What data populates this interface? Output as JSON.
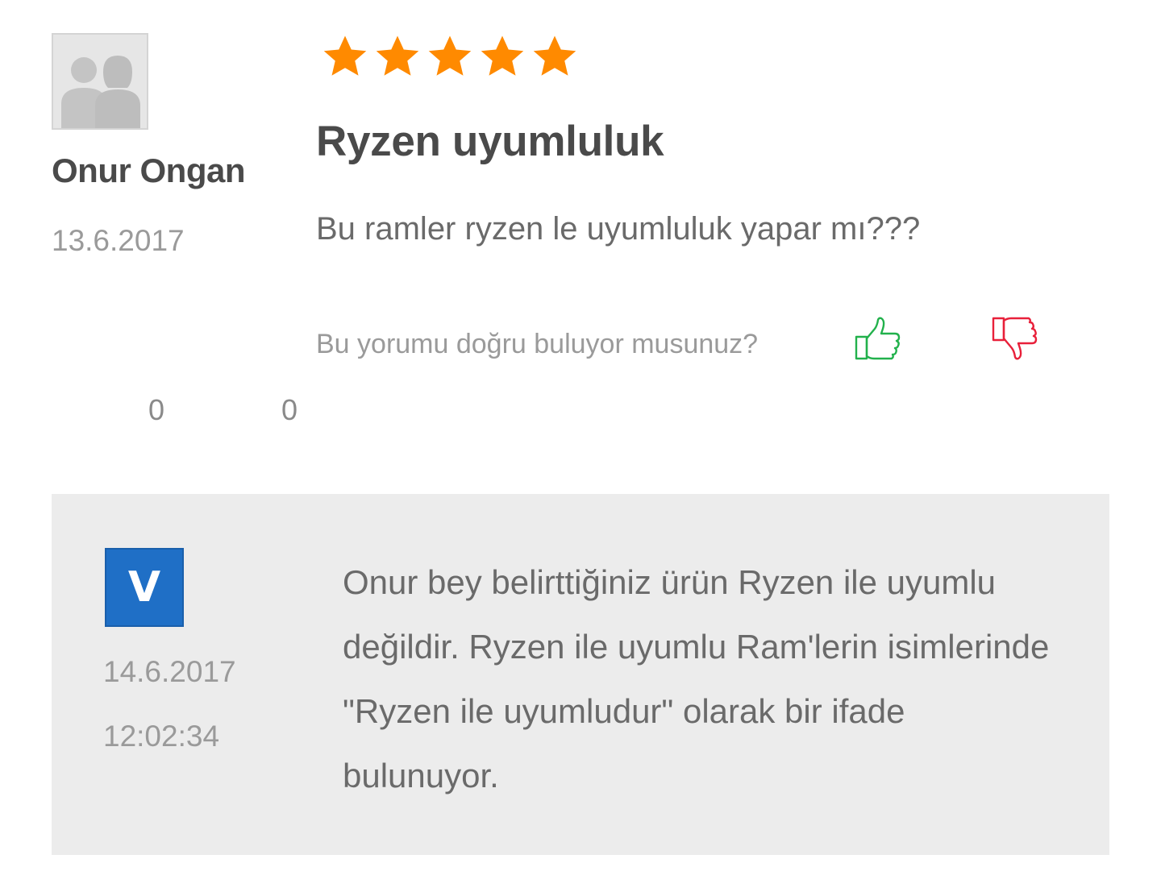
{
  "review": {
    "reviewer_name": "Onur Ongan",
    "date": "13.6.2017",
    "rating": 5,
    "rating_max": 5,
    "title": "Ryzen uyumluluk",
    "body": "Bu ramler ryzen le uyumluluk yapar mı???",
    "helpful_question": "Bu yorumu doğru buluyor musunuz?",
    "like_count": "0",
    "dislike_count": "0",
    "avatar_icon": "default-user-silhouette-icon",
    "like_icon": "thumbs-up-icon",
    "dislike_icon": "thumbs-down-icon",
    "colors": {
      "star": "#ff8a00",
      "like": "#22b14c",
      "dislike": "#e8203a",
      "reply_bg": "#ececec",
      "store_logo": "#1f6fc6"
    }
  },
  "reply": {
    "store_logo_letter": "V",
    "date": "14.6.2017",
    "time": "12:02:34",
    "text": "Onur bey belirttiğiniz ürün Ryzen ile uyumlu değildir. Ryzen ile uyumlu Ram'lerin isimlerinde \"Ryzen ile uyumludur\" olarak bir ifade bulunuyor."
  }
}
